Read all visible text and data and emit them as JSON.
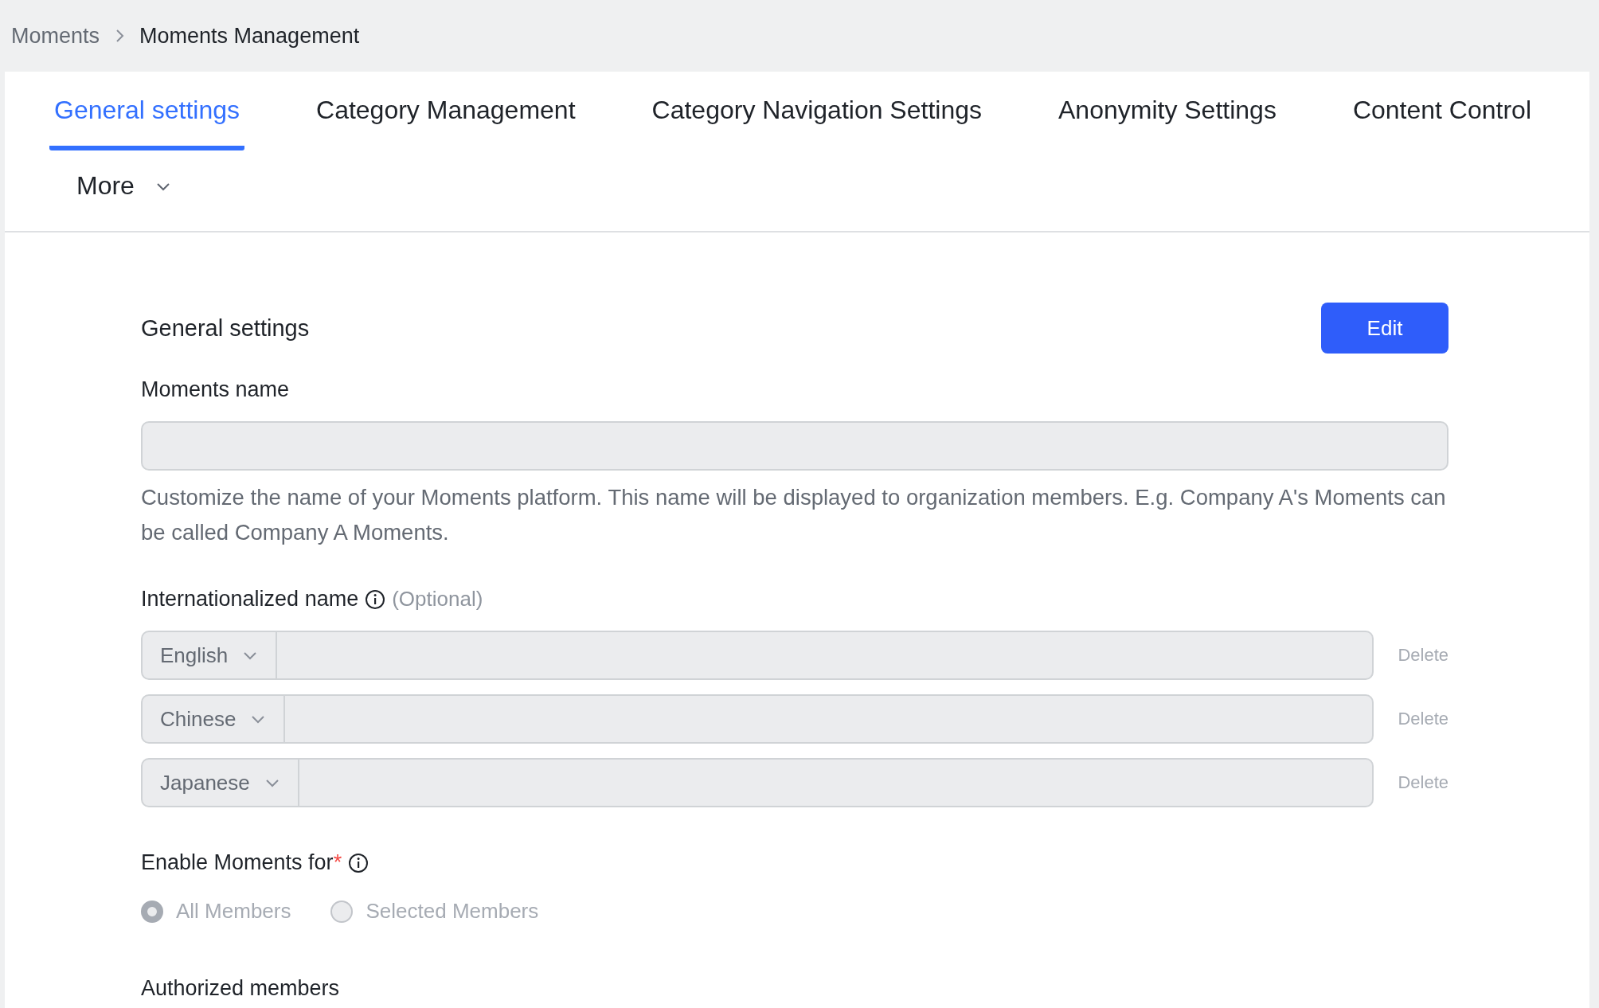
{
  "breadcrumb": [
    {
      "label": "Moments"
    },
    {
      "label": "Moments Management"
    }
  ],
  "tabs": [
    {
      "label": "General settings",
      "selected": true
    },
    {
      "label": "Category Management",
      "selected": false
    },
    {
      "label": "Category Navigation Settings",
      "selected": false
    },
    {
      "label": "Anonymity Settings",
      "selected": false
    },
    {
      "label": "Content Control",
      "selected": false
    }
  ],
  "more_tab": {
    "label": "More"
  },
  "section": {
    "title": "General settings",
    "edit_button": "Edit"
  },
  "moments_name": {
    "label": "Moments name",
    "help": "Customize the name of your Moments platform. This name will be displayed to organization members. E.g. Company A's Moments can be called Company A Moments."
  },
  "internationalized_name": {
    "label": "Internationalized name",
    "optional": "(Optional)",
    "rows": [
      {
        "language": "English",
        "delete": "Delete"
      },
      {
        "language": "Chinese",
        "delete": "Delete"
      },
      {
        "language": "Japanese",
        "delete": "Delete"
      }
    ]
  },
  "enable_for": {
    "label": "Enable Moments for",
    "required_mark": "*",
    "disabled": true,
    "options": [
      {
        "label": "All Members",
        "selected": true
      },
      {
        "label": "Selected Members",
        "selected": false
      }
    ]
  },
  "authorized_members": {
    "label": "Authorized members"
  }
}
